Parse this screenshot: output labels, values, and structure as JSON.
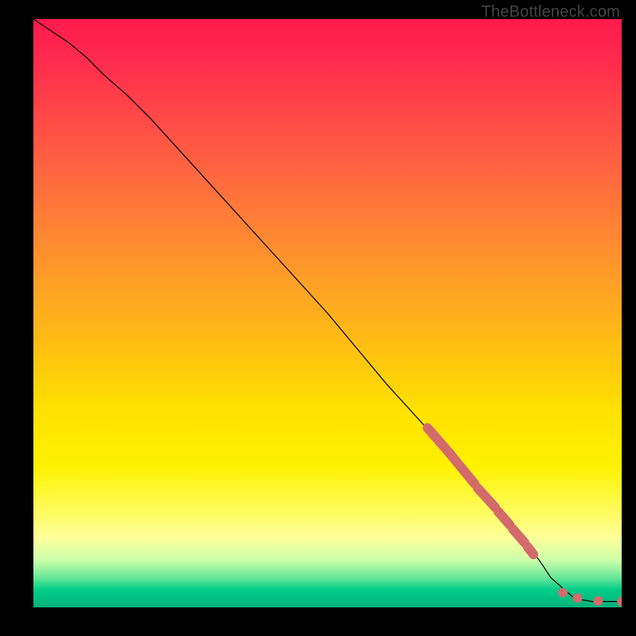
{
  "watermark": "TheBottleneck.com",
  "chart_data": {
    "type": "line",
    "title": "",
    "xlabel": "",
    "ylabel": "",
    "xlim": [
      0,
      100
    ],
    "ylim": [
      0,
      100
    ],
    "grid": false,
    "legend": false,
    "series": [
      {
        "name": "curve",
        "x": [
          0,
          3,
          6,
          9,
          12,
          16,
          20,
          30,
          40,
          50,
          60,
          70,
          80,
          86,
          88,
          92,
          95,
          100
        ],
        "y": [
          100,
          98,
          96,
          93.5,
          90.5,
          87,
          83,
          72,
          61,
          50,
          38,
          27,
          15.5,
          8,
          5,
          1.5,
          1,
          1
        ]
      }
    ],
    "markers": {
      "segments": [
        {
          "x1": 67,
          "y1": 30.5,
          "x2": 70.5,
          "y2": 26.5
        },
        {
          "x1": 70.5,
          "y1": 26.5,
          "x2": 75,
          "y2": 21
        },
        {
          "x1": 75.5,
          "y1": 20.3,
          "x2": 78.5,
          "y2": 17
        },
        {
          "x1": 79,
          "y1": 16.3,
          "x2": 81,
          "y2": 14
        },
        {
          "x1": 81.5,
          "y1": 13.3,
          "x2": 83.5,
          "y2": 11
        },
        {
          "x1": 84,
          "y1": 10.3,
          "x2": 85,
          "y2": 9
        }
      ],
      "dots": [
        {
          "x": 90,
          "y": 2.5
        },
        {
          "x": 92.5,
          "y": 1.6
        },
        {
          "x": 96,
          "y": 1.1
        },
        {
          "x": 100,
          "y": 1
        }
      ]
    }
  }
}
